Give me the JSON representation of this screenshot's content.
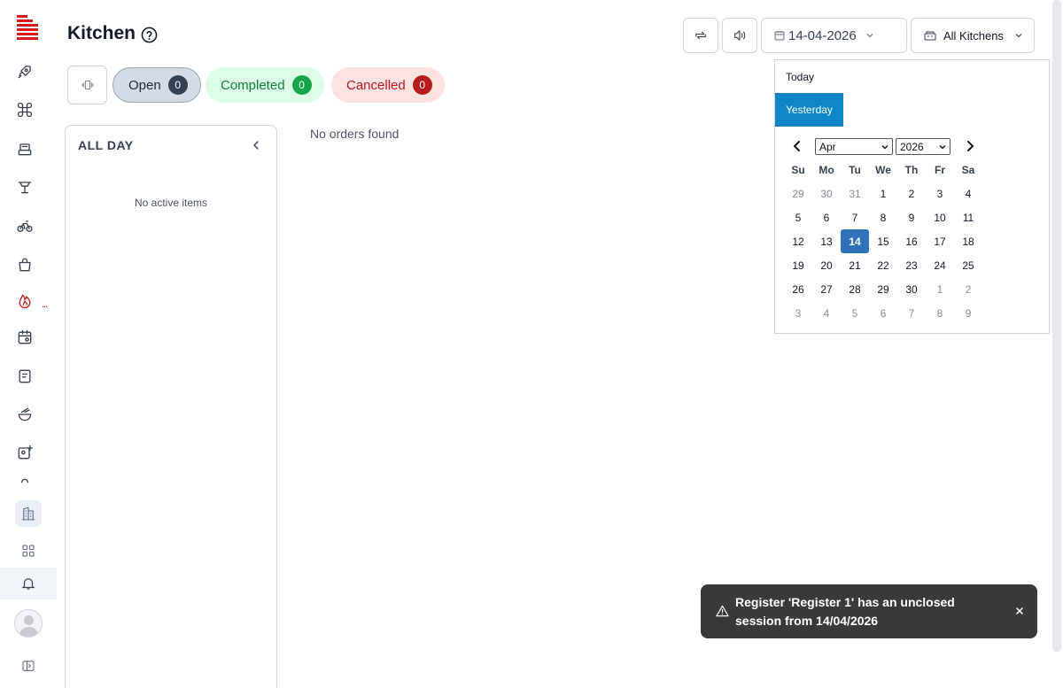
{
  "header": {
    "title": "Kitchen",
    "date_value": "14-04-2026",
    "kitchen_filter": "All Kitchens"
  },
  "tabs": [
    {
      "label": "Open",
      "count": "0"
    },
    {
      "label": "Completed",
      "count": "0"
    },
    {
      "label": "Cancelled",
      "count": "0"
    }
  ],
  "all_day": {
    "title": "ALL DAY",
    "empty_text": "No active items"
  },
  "main": {
    "empty_text": "No orders found"
  },
  "date_picker": {
    "presets": [
      "Today",
      "Yesterday"
    ],
    "selected_preset": "Yesterday",
    "month": "Apr",
    "year": "2026",
    "weekdays": [
      "Su",
      "Mo",
      "Tu",
      "We",
      "Th",
      "Fr",
      "Sa"
    ],
    "weeks": [
      [
        "29",
        "30",
        "31",
        "1",
        "2",
        "3",
        "4"
      ],
      [
        "5",
        "6",
        "7",
        "8",
        "9",
        "10",
        "11"
      ],
      [
        "12",
        "13",
        "14",
        "15",
        "16",
        "17",
        "18"
      ],
      [
        "19",
        "20",
        "21",
        "22",
        "23",
        "24",
        "25"
      ],
      [
        "26",
        "27",
        "28",
        "29",
        "30",
        "1",
        "2"
      ],
      [
        "3",
        "4",
        "5",
        "6",
        "7",
        "8",
        "9"
      ]
    ],
    "selected_day": "14"
  },
  "sidebar": {
    "active_indicator": "..."
  },
  "toast": {
    "message": "Register 'Register 1' has an unclosed session from 14/04/2026"
  },
  "colors": {
    "brand": "#c81e1e",
    "preset_active": "#0e86c8",
    "day_selected": "#3072ba",
    "completed": "#16a34a",
    "cancelled": "#b91c1c"
  }
}
